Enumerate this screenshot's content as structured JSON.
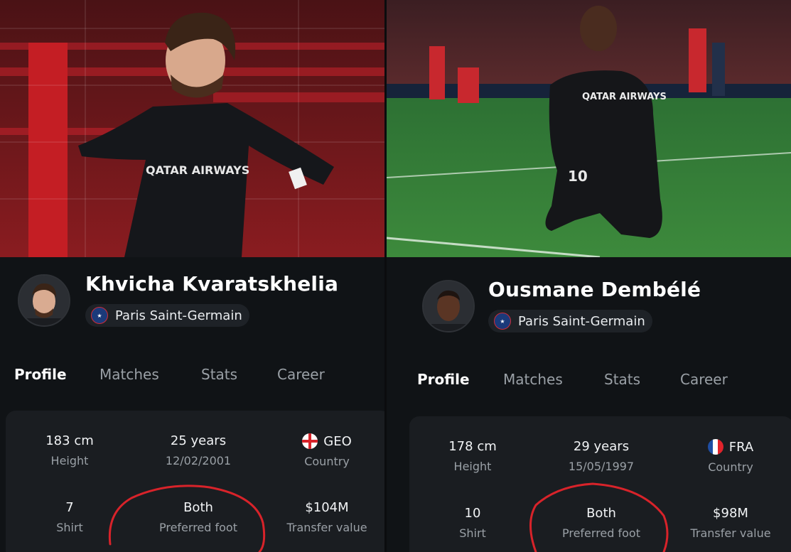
{
  "players": [
    {
      "name": "Khvicha Kvaratskhelia",
      "club": "Paris Saint-Germain",
      "club_badge_icon": "psg-crest-icon",
      "tabs": [
        "Profile",
        "Matches",
        "Stats",
        "Career"
      ],
      "active_tab": "Profile",
      "stats": {
        "height": {
          "value": "183 cm",
          "label": "Height"
        },
        "age": {
          "value": "25 years",
          "label": "12/02/2001"
        },
        "country": {
          "value": "GEO",
          "label": "Country",
          "flag_icon": "georgia-flag-icon"
        },
        "shirt": {
          "value": "7",
          "label": "Shirt"
        },
        "foot": {
          "value": "Both",
          "label": "Preferred foot"
        },
        "transfer": {
          "value": "$104M",
          "label": "Transfer value"
        }
      }
    },
    {
      "name": "Ousmane Dembélé",
      "club": "Paris Saint-Germain",
      "club_badge_icon": "psg-crest-icon",
      "tabs": [
        "Profile",
        "Matches",
        "Stats",
        "Career"
      ],
      "active_tab": "Profile",
      "stats": {
        "height": {
          "value": "178 cm",
          "label": "Height"
        },
        "age": {
          "value": "29 years",
          "label": "15/05/1997"
        },
        "country": {
          "value": "FRA",
          "label": "Country",
          "flag_icon": "france-flag-icon"
        },
        "shirt": {
          "value": "10",
          "label": "Shirt"
        },
        "foot": {
          "value": "Both",
          "label": "Preferred foot"
        },
        "transfer": {
          "value": "$98M",
          "label": "Transfer value"
        }
      }
    }
  ],
  "photos": {
    "left_jersey_sponsor": "QATAR AIRWAYS",
    "right_jersey_sponsor": "QATAR AIRWAYS",
    "right_shirt_number": "10"
  },
  "annotation_color": "#d8232a"
}
